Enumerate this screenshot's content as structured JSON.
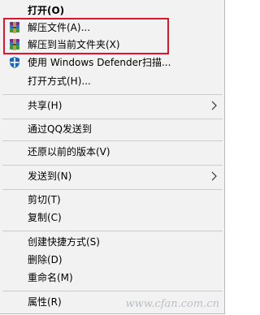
{
  "menu": {
    "items": [
      {
        "label": "打开(O)"
      },
      {
        "label": "解压文件(A)...",
        "icon": "winrar-icon"
      },
      {
        "label": "解压到当前文件夹(X)",
        "icon": "winrar-icon"
      },
      {
        "label": "使用 Windows Defender扫描...",
        "icon": "windows-defender-icon"
      },
      {
        "label": "打开方式(H)..."
      },
      {
        "label": "共享(H)",
        "submenu": true
      },
      {
        "label": "通过QQ发送到"
      },
      {
        "label": "还原以前的版本(V)"
      },
      {
        "label": "发送到(N)",
        "submenu": true
      },
      {
        "label": "剪切(T)"
      },
      {
        "label": "复制(C)"
      },
      {
        "label": "创建快捷方式(S)"
      },
      {
        "label": "删除(D)"
      },
      {
        "label": "重命名(M)"
      },
      {
        "label": "属性(R)"
      }
    ]
  },
  "highlight_color": "#e0142d",
  "watermark": "www.cfan.com.cn"
}
